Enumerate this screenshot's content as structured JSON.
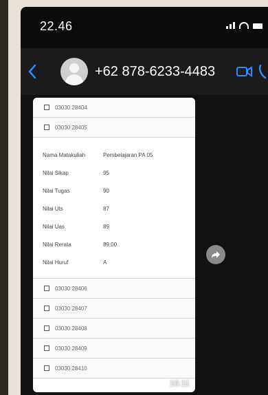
{
  "status_bar": {
    "time": "22.46"
  },
  "header": {
    "contact_name": "+62 878-6233-4483"
  },
  "message": {
    "top_items": [
      "03030 28404",
      "03030 28405"
    ],
    "details": [
      {
        "key": "Nama Matakuliah",
        "value": "Pembelajaran PA 05"
      },
      {
        "key": "Nilai Sikap",
        "value": "95"
      },
      {
        "key": "Nilai Tugas",
        "value": "90"
      },
      {
        "key": "Nilai Uts",
        "value": "87"
      },
      {
        "key": "Nilai Uas",
        "value": "89"
      },
      {
        "key": "Nilai Rerata",
        "value": "89,00"
      },
      {
        "key": "Nilai Huruf",
        "value": "A"
      }
    ],
    "bottom_items": [
      "03030 28406",
      "03030 28407",
      "03030 28408",
      "03030 28409",
      "03030 28410"
    ],
    "timestamp": "10.11"
  }
}
